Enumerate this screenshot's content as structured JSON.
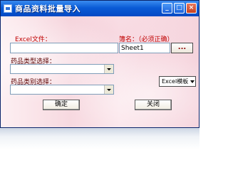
{
  "window": {
    "title": "商品资料批量导入",
    "minimize_glyph": "_",
    "maximize_glyph": "□",
    "close_glyph": "×"
  },
  "form": {
    "excel_file_label": "Excel文件：",
    "excel_file_value": "",
    "sheet_label": "簿名：（必须正确）",
    "sheet_value": "Sheet1",
    "browse_label": "...",
    "product_type_label": "药品类型选择：",
    "product_type_value": "",
    "product_category_label": "药品类别选择：",
    "product_category_value": "",
    "template_button_label": "Excel模板",
    "ok_button_label": "确定",
    "close_button_label": "关闭"
  },
  "colors": {
    "label_red": "#c00000",
    "label_dark": "#5a0000",
    "titlebar": "#0a5bd6"
  },
  "icons": {
    "app": "window-app-icon",
    "dropdown": "chevron-down-icon"
  }
}
